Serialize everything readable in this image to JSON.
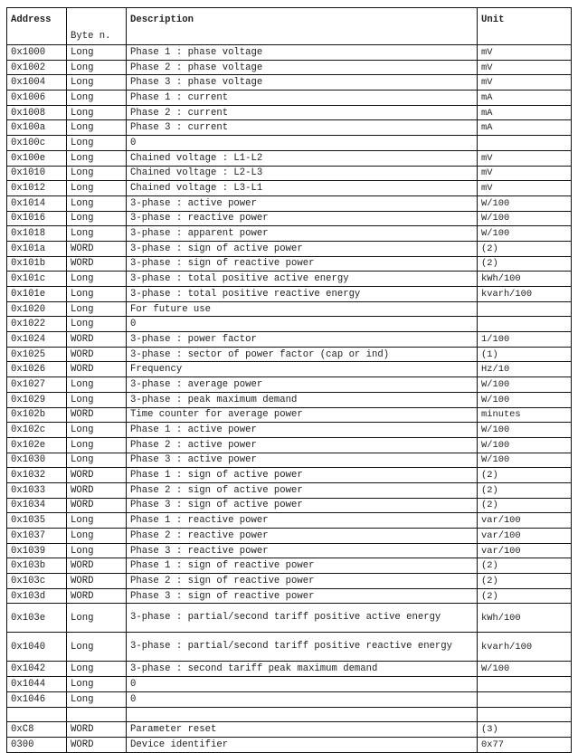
{
  "table": {
    "headers": {
      "address": "Address",
      "byte": "Byte n.",
      "description": "Description",
      "unit": "Unit"
    },
    "rows": [
      {
        "address": "0x1000",
        "byte": "Long",
        "description": "Phase 1 : phase voltage",
        "unit": "mV"
      },
      {
        "address": "0x1002",
        "byte": "Long",
        "description": "Phase 2 : phase voltage",
        "unit": "mV"
      },
      {
        "address": "0x1004",
        "byte": "Long",
        "description": "Phase 3 : phase voltage",
        "unit": "mV"
      },
      {
        "address": "0x1006",
        "byte": "Long",
        "description": "Phase 1 : current",
        "unit": "mA"
      },
      {
        "address": "0x1008",
        "byte": "Long",
        "description": "Phase 2 : current",
        "unit": "mA"
      },
      {
        "address": "0x100a",
        "byte": "Long",
        "description": "Phase 3 : current",
        "unit": "mA"
      },
      {
        "address": "0x100c",
        "byte": "Long",
        "description": "0",
        "unit": ""
      },
      {
        "address": "0x100e",
        "byte": "Long",
        "description": "Chained voltage : L1-L2",
        "unit": "mV"
      },
      {
        "address": "0x1010",
        "byte": "Long",
        "description": "Chained voltage : L2-L3",
        "unit": "mV"
      },
      {
        "address": "0x1012",
        "byte": "Long",
        "description": "Chained voltage : L3-L1",
        "unit": "mV"
      },
      {
        "address": "0x1014",
        "byte": "Long",
        "description": "3-phase : active power",
        "unit": "W/100"
      },
      {
        "address": "0x1016",
        "byte": "Long",
        "description": "3-phase : reactive power",
        "unit": "W/100"
      },
      {
        "address": "0x1018",
        "byte": "Long",
        "description": "3-phase : apparent power",
        "unit": "W/100"
      },
      {
        "address": "0x101a",
        "byte": "WORD",
        "description": "3-phase : sign of active power",
        "unit": "(2)"
      },
      {
        "address": "0x101b",
        "byte": "WORD",
        "description": "3-phase : sign of reactive power",
        "unit": "(2)"
      },
      {
        "address": "0x101c",
        "byte": "Long",
        "description": "3-phase : total positive active energy",
        "unit": "kWh/100"
      },
      {
        "address": "0x101e",
        "byte": "Long",
        "description": "3-phase : total positive reactive energy",
        "unit": "kvarh/100"
      },
      {
        "address": "0x1020",
        "byte": "Long",
        "description": "For future use",
        "unit": ""
      },
      {
        "address": "0x1022",
        "byte": "Long",
        "description": "0",
        "unit": ""
      },
      {
        "address": "0x1024",
        "byte": "WORD",
        "description": "3-phase : power factor",
        "unit": "1/100"
      },
      {
        "address": "0x1025",
        "byte": "WORD",
        "description": "3-phase : sector of power factor (cap or ind)",
        "unit": "(1)"
      },
      {
        "address": "0x1026",
        "byte": "WORD",
        "description": "Frequency",
        "unit": "Hz/10"
      },
      {
        "address": "0x1027",
        "byte": "Long",
        "description": "3-phase : average power",
        "unit": "W/100"
      },
      {
        "address": "0x1029",
        "byte": "Long",
        "description": "3-phase : peak maximum demand",
        "unit": "W/100"
      },
      {
        "address": "0x102b",
        "byte": "WORD",
        "description": "Time counter for average power",
        "unit": "minutes"
      },
      {
        "address": "0x102c",
        "byte": "Long",
        "description": "Phase 1 : active power",
        "unit": "W/100"
      },
      {
        "address": "0x102e",
        "byte": "Long",
        "description": "Phase 2 : active power",
        "unit": "W/100"
      },
      {
        "address": "0x1030",
        "byte": "Long",
        "description": "Phase 3 : active power",
        "unit": "W/100"
      },
      {
        "address": "0x1032",
        "byte": "WORD",
        "description": "Phase 1 : sign of active power",
        "unit": "(2)"
      },
      {
        "address": "0x1033",
        "byte": "WORD",
        "description": "Phase 2 : sign of active power",
        "unit": "(2)"
      },
      {
        "address": "0x1034",
        "byte": "WORD",
        "description": "Phase 3 : sign of active power",
        "unit": "(2)"
      },
      {
        "address": "0x1035",
        "byte": "Long",
        "description": "Phase 1 : reactive power",
        "unit": "var/100"
      },
      {
        "address": "0x1037",
        "byte": "Long",
        "description": "Phase 2 : reactive power",
        "unit": "var/100"
      },
      {
        "address": "0x1039",
        "byte": "Long",
        "description": "Phase 3 : reactive power",
        "unit": "var/100"
      },
      {
        "address": "0x103b",
        "byte": "WORD",
        "description": "Phase 1 : sign of reactive power",
        "unit": "(2)"
      },
      {
        "address": "0x103c",
        "byte": "WORD",
        "description": "Phase 2 : sign of reactive power",
        "unit": "(2)"
      },
      {
        "address": "0x103d",
        "byte": "WORD",
        "description": "Phase 3 : sign of reactive power",
        "unit": "(2)"
      },
      {
        "address": "0x103e",
        "byte": "Long",
        "description": "3-phase : partial/second tariff positive active energy",
        "unit": "kWh/100",
        "tall": true
      },
      {
        "address": "0x1040",
        "byte": "Long",
        "description": "3-phase : partial/second tariff positive reactive energy",
        "unit": "kvarh/100",
        "tall": true
      },
      {
        "address": "0x1042",
        "byte": "Long",
        "description": "3-phase : second tariff peak maximum demand",
        "unit": "W/100"
      },
      {
        "address": "0x1044",
        "byte": "Long",
        "description": "0",
        "unit": ""
      },
      {
        "address": "0x1046",
        "byte": "Long",
        "description": "0",
        "unit": ""
      },
      {
        "address": "",
        "byte": "",
        "description": "",
        "unit": ""
      },
      {
        "address": "0xC8",
        "byte": "WORD",
        "description": "Parameter reset",
        "unit": "(3)"
      },
      {
        "address": "0300",
        "byte": "WORD",
        "description": "Device identifier",
        "unit": "0x77"
      }
    ]
  }
}
